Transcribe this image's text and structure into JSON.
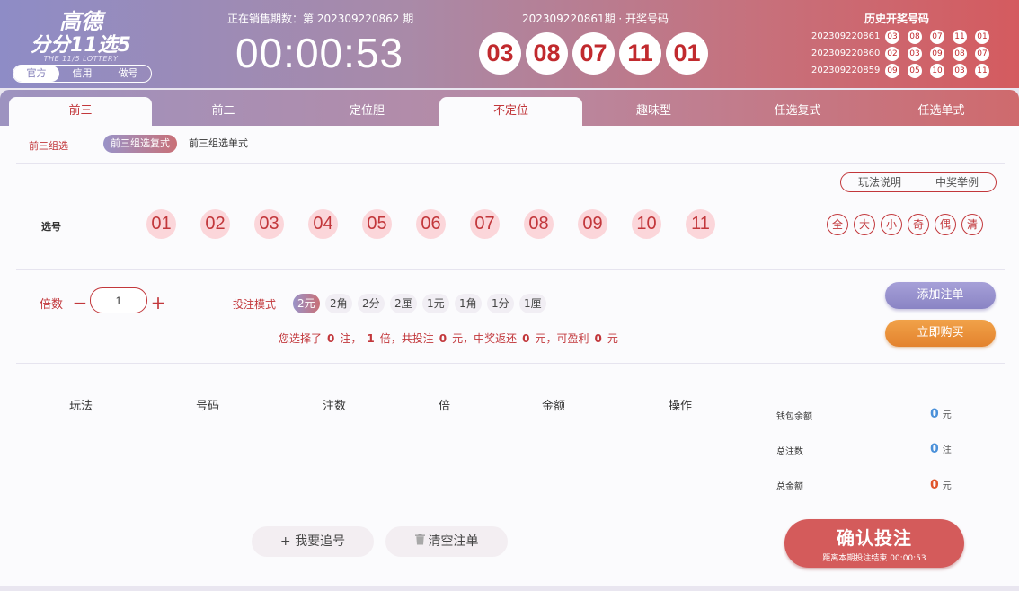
{
  "logo": {
    "line1": "高德",
    "line2": "分分11选5",
    "english": "THE 11/5 LOTTERY"
  },
  "account_modes": [
    {
      "label": "官方",
      "active": true
    },
    {
      "label": "信用",
      "active": false
    },
    {
      "label": "做号",
      "active": false
    }
  ],
  "current": {
    "label": "正在销售期数：第 202309220862 期",
    "countdown": "00:00:53"
  },
  "last_draw": {
    "label": "202309220861期 · 开奖号码",
    "numbers": [
      "03",
      "08",
      "07",
      "11",
      "01"
    ]
  },
  "history": {
    "title": "历史开奖号码",
    "rows": [
      {
        "period": "202309220861",
        "numbers": [
          "03",
          "08",
          "07",
          "11",
          "01"
        ]
      },
      {
        "period": "202309220860",
        "numbers": [
          "02",
          "03",
          "09",
          "08",
          "07"
        ]
      },
      {
        "period": "202309220859",
        "numbers": [
          "09",
          "05",
          "10",
          "03",
          "11"
        ]
      }
    ]
  },
  "tabs": [
    {
      "label": "前三",
      "active": true
    },
    {
      "label": "前二",
      "active": false
    },
    {
      "label": "定位胆",
      "active": false
    },
    {
      "label": "不定位",
      "active": true
    },
    {
      "label": "趣味型",
      "active": false
    },
    {
      "label": "任选复式",
      "active": false
    },
    {
      "label": "任选单式",
      "active": false
    }
  ],
  "subtype": {
    "group_label": "前三组选",
    "options": [
      {
        "label": "前三组选复式",
        "active": true
      },
      {
        "label": "前三组选单式",
        "active": false
      }
    ]
  },
  "info_buttons": [
    "玩法说明",
    "中奖举例"
  ],
  "pick": {
    "label": "选号",
    "numbers": [
      "01",
      "02",
      "03",
      "04",
      "05",
      "06",
      "07",
      "08",
      "09",
      "10",
      "11"
    ],
    "quick": [
      "全",
      "大",
      "小",
      "奇",
      "偶",
      "清"
    ]
  },
  "multiplier": {
    "label": "倍数",
    "minus": "−",
    "plus": "+",
    "value": "1"
  },
  "bet_mode": {
    "label": "投注模式",
    "units": [
      {
        "label": "2元",
        "active": true
      },
      {
        "label": "2角",
        "active": false
      },
      {
        "label": "2分",
        "active": false
      },
      {
        "label": "2厘",
        "active": false
      },
      {
        "label": "1元",
        "active": false
      },
      {
        "label": "1角",
        "active": false
      },
      {
        "label": "1分",
        "active": false
      },
      {
        "label": "1厘",
        "active": false
      }
    ]
  },
  "summary": {
    "t1": "您选择了",
    "bets": "0",
    "t2": "注，",
    "multiple": "1",
    "t3": "倍，共投注",
    "amount": "0",
    "t4": "元，中奖返还",
    "return": "0",
    "t5": "元，可盈利",
    "profit": "0",
    "t6": "元"
  },
  "actions": {
    "add": "添加注单",
    "buy": "立即购买"
  },
  "table_headers": [
    "玩法",
    "号码",
    "注数",
    "倍",
    "金额",
    "操作"
  ],
  "stats": [
    {
      "label": "钱包余额",
      "value": "0",
      "unit": "元",
      "color": "#4a90d9"
    },
    {
      "label": "总注数",
      "value": "0",
      "unit": "注",
      "color": "#4a90d9"
    },
    {
      "label": "总金额",
      "value": "0",
      "unit": "元",
      "color": "#e0552b"
    }
  ],
  "bottom": {
    "chase": "+ 我要追号",
    "clear": "清空注单",
    "confirm": "确认投注",
    "confirm_sub": "距离本期投注结束 00:00:53"
  },
  "colors": {
    "accent": "#c2373b",
    "ball_bg": "#fbd6da",
    "confirm": "#d45b5b"
  }
}
